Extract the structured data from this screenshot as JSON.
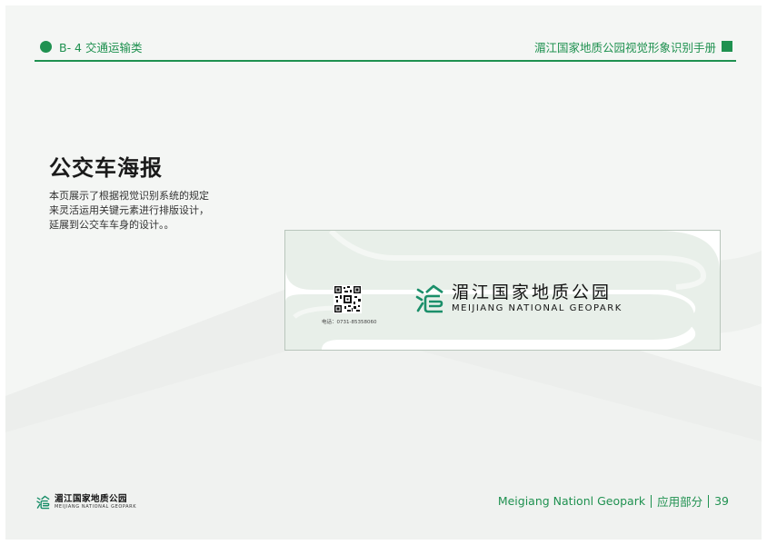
{
  "header": {
    "section": "B- 4 交通运输类",
    "manual_title": "湄江国家地质公园视觉形象识别手册"
  },
  "content": {
    "title": "公交车海报",
    "description_lines": [
      "本页展示了根据视觉识别系统的规定",
      "来灵活运用关键元素进行排版设计，",
      "延展到公交车车身的设计。。"
    ]
  },
  "poster": {
    "phone": "电话：0731-85358060",
    "logo_cn": "湄江国家地质公园",
    "logo_en": "MEIJIANG NATIONAL GEOPARK"
  },
  "footer": {
    "logo_cn": "湄江国家地质公园",
    "logo_en": "MEIJIANG NATIONAL GEOPARK",
    "park_name": "Meigiang Nationl Geopark",
    "part": "应用部分",
    "page_number": "39"
  },
  "colors": {
    "brand_green": "#1f9150",
    "logo_teal": "#1b8f6a",
    "background": "#f4f6f4"
  },
  "icons": [
    "logo-mark-icon",
    "qr-code-icon"
  ]
}
